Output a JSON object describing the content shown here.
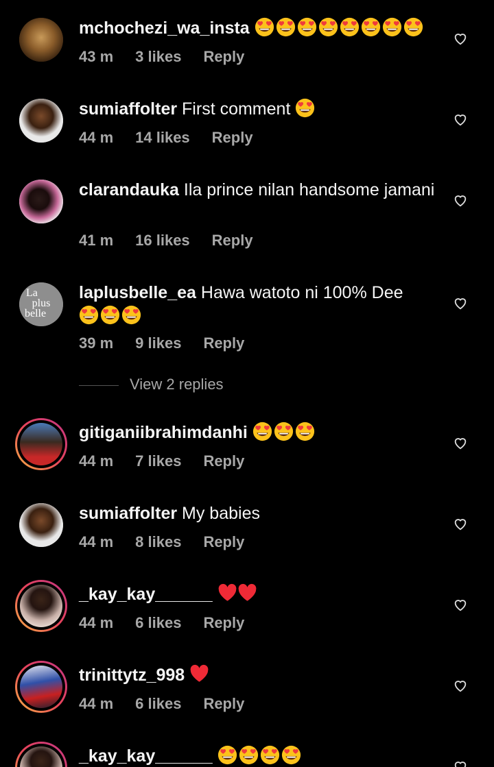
{
  "comments": [
    {
      "username": "mchochezi_wa_insta",
      "text": "",
      "emojis": 8,
      "time": "43 m",
      "likes": "3 likes",
      "reply": "Reply"
    },
    {
      "username": "sumiaffolter",
      "text": " First comment ",
      "emojis": 1,
      "time": "44 m",
      "likes": "14 likes",
      "reply": "Reply"
    },
    {
      "username": "clarandauka",
      "text": " Ila prince nilan handsome jamani",
      "emojis": 0,
      "time": "41 m",
      "likes": "16 likes",
      "reply": "Reply"
    },
    {
      "username": "laplusbelle_ea",
      "text": " Hawa watoto ni 100% Dee",
      "emojis": 3,
      "time": "39 m",
      "likes": "9 likes",
      "reply": "Reply",
      "avatar_text": [
        "La",
        "plus",
        "belle"
      ]
    },
    {
      "username": "gitiganiibrahimdanhi",
      "text": "",
      "emojis": 3,
      "time": "44 m",
      "likes": "7 likes",
      "reply": "Reply"
    },
    {
      "username": "sumiaffolter",
      "text": " My babies",
      "emojis": 0,
      "time": "44 m",
      "likes": "8 likes",
      "reply": "Reply"
    },
    {
      "username": "_kay_kay______",
      "text": "",
      "hearts": 2,
      "time": "44 m",
      "likes": "6 likes",
      "reply": "Reply"
    },
    {
      "username": "trinittytz_998",
      "text": "",
      "hearts": 1,
      "time": "44 m",
      "likes": "6 likes",
      "reply": "Reply"
    },
    {
      "username": "_kay_kay______",
      "text": "",
      "emojis": 4,
      "time": "",
      "likes": "",
      "reply": ""
    }
  ],
  "view_replies": "View 2 replies",
  "icons": {
    "like": "heart-outline-icon",
    "emoji": "heart-eyes-emoji",
    "red_heart": "red-heart-emoji"
  }
}
